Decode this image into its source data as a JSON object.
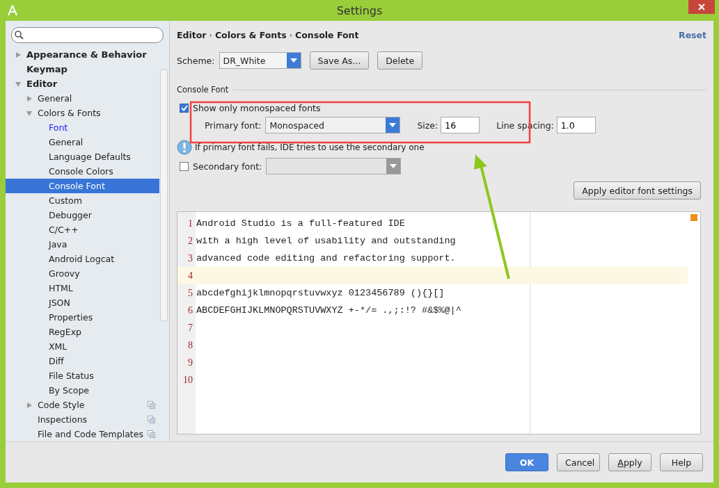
{
  "window": {
    "title": "Settings"
  },
  "sidebar": {
    "tree": [
      {
        "label": "Appearance & Behavior",
        "expanded": false,
        "selected": false,
        "modified": false
      },
      {
        "label": "Keymap",
        "selected": false,
        "modified": false
      },
      {
        "label": "Editor",
        "expanded": true,
        "selected": false,
        "modified": false,
        "children": [
          {
            "label": "General",
            "expanded": false,
            "selected": false,
            "modified": false
          },
          {
            "label": "Colors & Fonts",
            "expanded": true,
            "selected": false,
            "modified": false,
            "children": [
              {
                "label": "Font",
                "selected": false,
                "modified": true
              },
              {
                "label": "General",
                "selected": false,
                "modified": false
              },
              {
                "label": "Language Defaults",
                "selected": false,
                "modified": false
              },
              {
                "label": "Console Colors",
                "selected": false,
                "modified": false
              },
              {
                "label": "Console Font",
                "selected": true,
                "modified": false
              },
              {
                "label": "Custom",
                "selected": false,
                "modified": false
              },
              {
                "label": "Debugger",
                "selected": false,
                "modified": false
              },
              {
                "label": "C/C++",
                "selected": false,
                "modified": false
              },
              {
                "label": "Java",
                "selected": false,
                "modified": false
              },
              {
                "label": "Android Logcat",
                "selected": false,
                "modified": false
              },
              {
                "label": "Groovy",
                "selected": false,
                "modified": false
              },
              {
                "label": "HTML",
                "selected": false,
                "modified": false
              },
              {
                "label": "JSON",
                "selected": false,
                "modified": false
              },
              {
                "label": "Properties",
                "selected": false,
                "modified": false
              },
              {
                "label": "RegExp",
                "selected": false,
                "modified": false
              },
              {
                "label": "XML",
                "selected": false,
                "modified": false
              },
              {
                "label": "Diff",
                "selected": false,
                "modified": false
              },
              {
                "label": "File Status",
                "selected": false,
                "modified": false
              },
              {
                "label": "By Scope",
                "selected": false,
                "modified": false
              }
            ]
          },
          {
            "label": "Code Style",
            "expanded": false,
            "selected": false,
            "modified": false,
            "project_level": true
          },
          {
            "label": "Inspections",
            "selected": false,
            "modified": false,
            "project_level": true
          },
          {
            "label": "File and Code Templates",
            "selected": false,
            "modified": false,
            "project_level": true
          }
        ]
      }
    ]
  },
  "breadcrumb": {
    "items": [
      "Editor",
      "Colors & Fonts",
      "Console Font"
    ],
    "separator": "›"
  },
  "reset_link": "Reset",
  "scheme": {
    "label": "Scheme:",
    "value": "DR_White",
    "buttons": [
      "Save As...",
      "Delete"
    ]
  },
  "section_title": "Console Font",
  "show_only_monospaced": {
    "label": "Show only monospaced fonts",
    "checked": true
  },
  "primary_font": {
    "label": "Primary font:",
    "value": "Monospaced"
  },
  "size": {
    "label": "Size:",
    "value": "16"
  },
  "line_spacing": {
    "label": "Line spacing:",
    "value": "1.0"
  },
  "info": "If primary font fails, IDE tries to use the secondary one",
  "secondary_font": {
    "label": "Secondary font:",
    "checked": false
  },
  "apply_editor_button": "Apply editor font settings",
  "preview_lines": [
    {
      "number": "1",
      "text": "Android Studio is a full-featured IDE",
      "current": false
    },
    {
      "number": "2",
      "text": "with a high level of usability and outstanding",
      "current": false
    },
    {
      "number": "3",
      "text": "advanced code editing and refactoring support.",
      "current": false
    },
    {
      "number": "4",
      "current": true
    },
    {
      "number": "5",
      "text": "abcdefghijklmnopqrstuvwxyz 0123456789 (){}[]",
      "current": false
    },
    {
      "number": "6",
      "text": "ABCDEFGHIJKLMNOPQRSTUVWXYZ +-*/= .,;:!? #&$%@|^",
      "current": false
    },
    {
      "number": "7",
      "current": false
    },
    {
      "number": "8",
      "current": false
    },
    {
      "number": "9",
      "current": false
    },
    {
      "number": "10",
      "current": false
    }
  ],
  "footer_buttons": [
    {
      "label": "OK",
      "kind": "primary"
    },
    {
      "label": "Cancel",
      "kind": "normal"
    },
    {
      "label": "Apply",
      "kind": "mnemonic"
    },
    {
      "label": "Help",
      "kind": "normal"
    }
  ]
}
